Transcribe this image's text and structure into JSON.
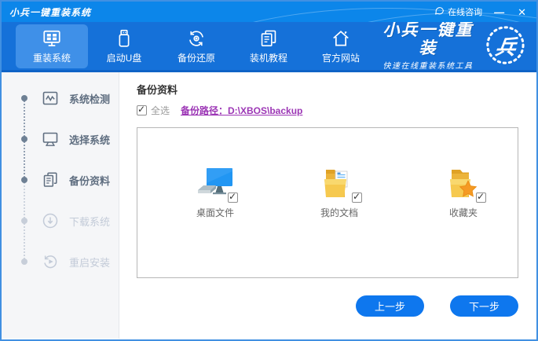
{
  "titlebar": {
    "title": "小兵一键重装系统",
    "online_service": "在线咨询",
    "minimize_glyph": "—",
    "close_glyph": "✕"
  },
  "nav": {
    "items": [
      {
        "label": "重装系统",
        "icon": "reinstall-system-icon",
        "active": true
      },
      {
        "label": "启动U盘",
        "icon": "boot-usb-icon",
        "active": false
      },
      {
        "label": "备份还原",
        "icon": "backup-restore-icon",
        "active": false
      },
      {
        "label": "装机教程",
        "icon": "tutorial-icon",
        "active": false
      },
      {
        "label": "官方网站",
        "icon": "official-site-icon",
        "active": false
      }
    ],
    "brand": {
      "logo_text": "小兵一键重装",
      "slogan": "快速在线重装系统工具",
      "badge_glyph": "兵"
    }
  },
  "sidebar": {
    "steps": [
      {
        "label": "系统检测",
        "icon": "system-check-icon",
        "state": "done"
      },
      {
        "label": "选择系统",
        "icon": "choose-system-icon",
        "state": "done"
      },
      {
        "label": "备份资料",
        "icon": "backup-data-icon",
        "state": "active"
      },
      {
        "label": "下载系统",
        "icon": "download-system-icon",
        "state": "pending"
      },
      {
        "label": "重启安装",
        "icon": "restart-install-icon",
        "state": "pending"
      }
    ]
  },
  "main": {
    "title": "备份资料",
    "select_all_label": "全选",
    "select_all_checked": true,
    "backup_path_link": "备份路径：D:\\XBOS\\backup",
    "items": [
      {
        "label": "桌面文件",
        "icon": "desktop-files-icon",
        "checked": true
      },
      {
        "label": "我的文档",
        "icon": "my-documents-icon",
        "checked": true
      },
      {
        "label": "收藏夹",
        "icon": "favorites-icon",
        "checked": true
      }
    ],
    "buttons": {
      "prev": "上一步",
      "next": "下一步"
    }
  },
  "colors": {
    "titlebar": "#0c86ea",
    "navbar": "#1571d9",
    "nav_active": "#3f90e8",
    "button": "#0e77ee",
    "link": "#9c36b5",
    "sidebar_bg": "#f5f6f8",
    "window_border": "#4190e2"
  }
}
